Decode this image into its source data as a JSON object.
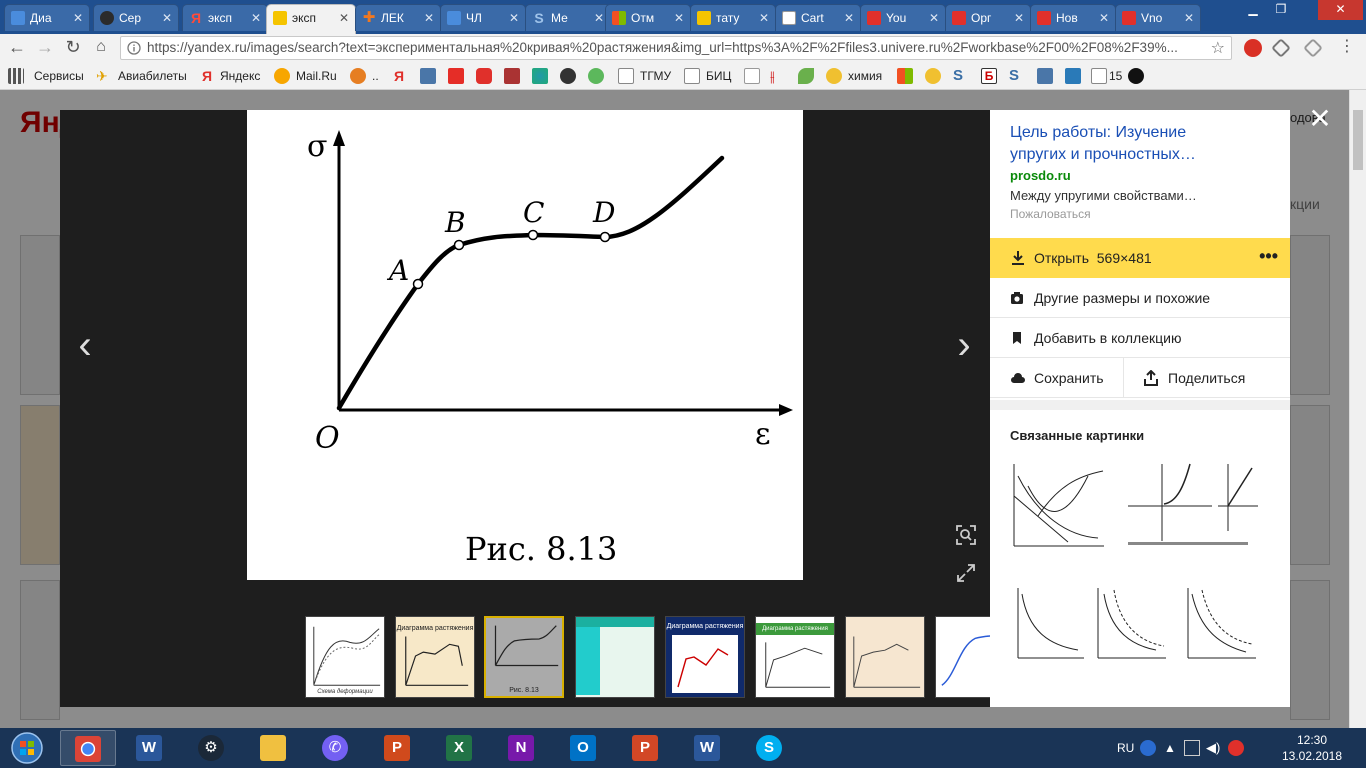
{
  "tabs": [
    {
      "label": "Диа",
      "color": "#4a8cdc"
    },
    {
      "label": "Сер",
      "color": "#2b2b2b"
    },
    {
      "label": "эксп",
      "color": "#e0302b"
    },
    {
      "label": "эксп",
      "color": "#f5c400",
      "active": true
    },
    {
      "label": "ЛЕК",
      "color": "#f07820"
    },
    {
      "label": "ЧЛ",
      "color": "#4a8cdc"
    },
    {
      "label": "Ме",
      "color": "#3a6ea5"
    },
    {
      "label": "Отм",
      "color": "#5aa02c"
    },
    {
      "label": "тату",
      "color": "#f5c400"
    },
    {
      "label": "Cart",
      "color": "#ffffff"
    },
    {
      "label": "You",
      "color": "#e0302b"
    },
    {
      "label": "Орг",
      "color": "#e0302b"
    },
    {
      "label": "Нов",
      "color": "#e0302b"
    },
    {
      "label": "Vno",
      "color": "#e0302b"
    }
  ],
  "address_bar": {
    "url": "https://yandex.ru/images/search?text=экспериментальная%20кривая%20растяжения&img_url=https%3A%2F%2Ffiles3.univere.ru%2Fworkbase%2F00%2F08%2F39%..."
  },
  "bookmarks": [
    {
      "label": "Сервисы"
    },
    {
      "label": "Авиабилеты"
    },
    {
      "label": "Яндекс"
    },
    {
      "label": "Mail.Ru"
    },
    {
      "label": ".."
    },
    {
      "label": "ТГМУ"
    },
    {
      "label": "БИЦ"
    },
    {
      "label": "химия"
    },
    {
      "label": "15"
    }
  ],
  "page": {
    "logo": "Янд",
    "right_text_1": "одова",
    "right_text_2": "кции"
  },
  "figure": {
    "axis_y": "σ",
    "axis_x": "ε",
    "origin": "O",
    "points": [
      "A",
      "B",
      "C",
      "D"
    ],
    "caption": "Рис. 8.13"
  },
  "panel": {
    "title": "Цель работы: Изучение упругих и прочностных…",
    "domain": "prosdo.ru",
    "description": "Между упругими свойствами…",
    "complain": "Пожаловаться",
    "open_label": "Открыть",
    "open_size": "569×481",
    "more": "•••",
    "other_sizes": "Другие размеры и похожие",
    "add_collection": "Добавить в коллекцию",
    "save": "Сохранить",
    "share": "Поделиться",
    "related_title": "Связанные картинки"
  },
  "thumb_captions": {
    "t2": "Диаграмма растяжения",
    "t5": "Диаграмма растяжения",
    "t6": "Диаграмма растяжения стали",
    "t1": "Схема деформации",
    "t3": "Рис. 8.13"
  },
  "taskbar": {
    "lang": "RU",
    "time": "12:30",
    "date": "13.02.2018"
  }
}
